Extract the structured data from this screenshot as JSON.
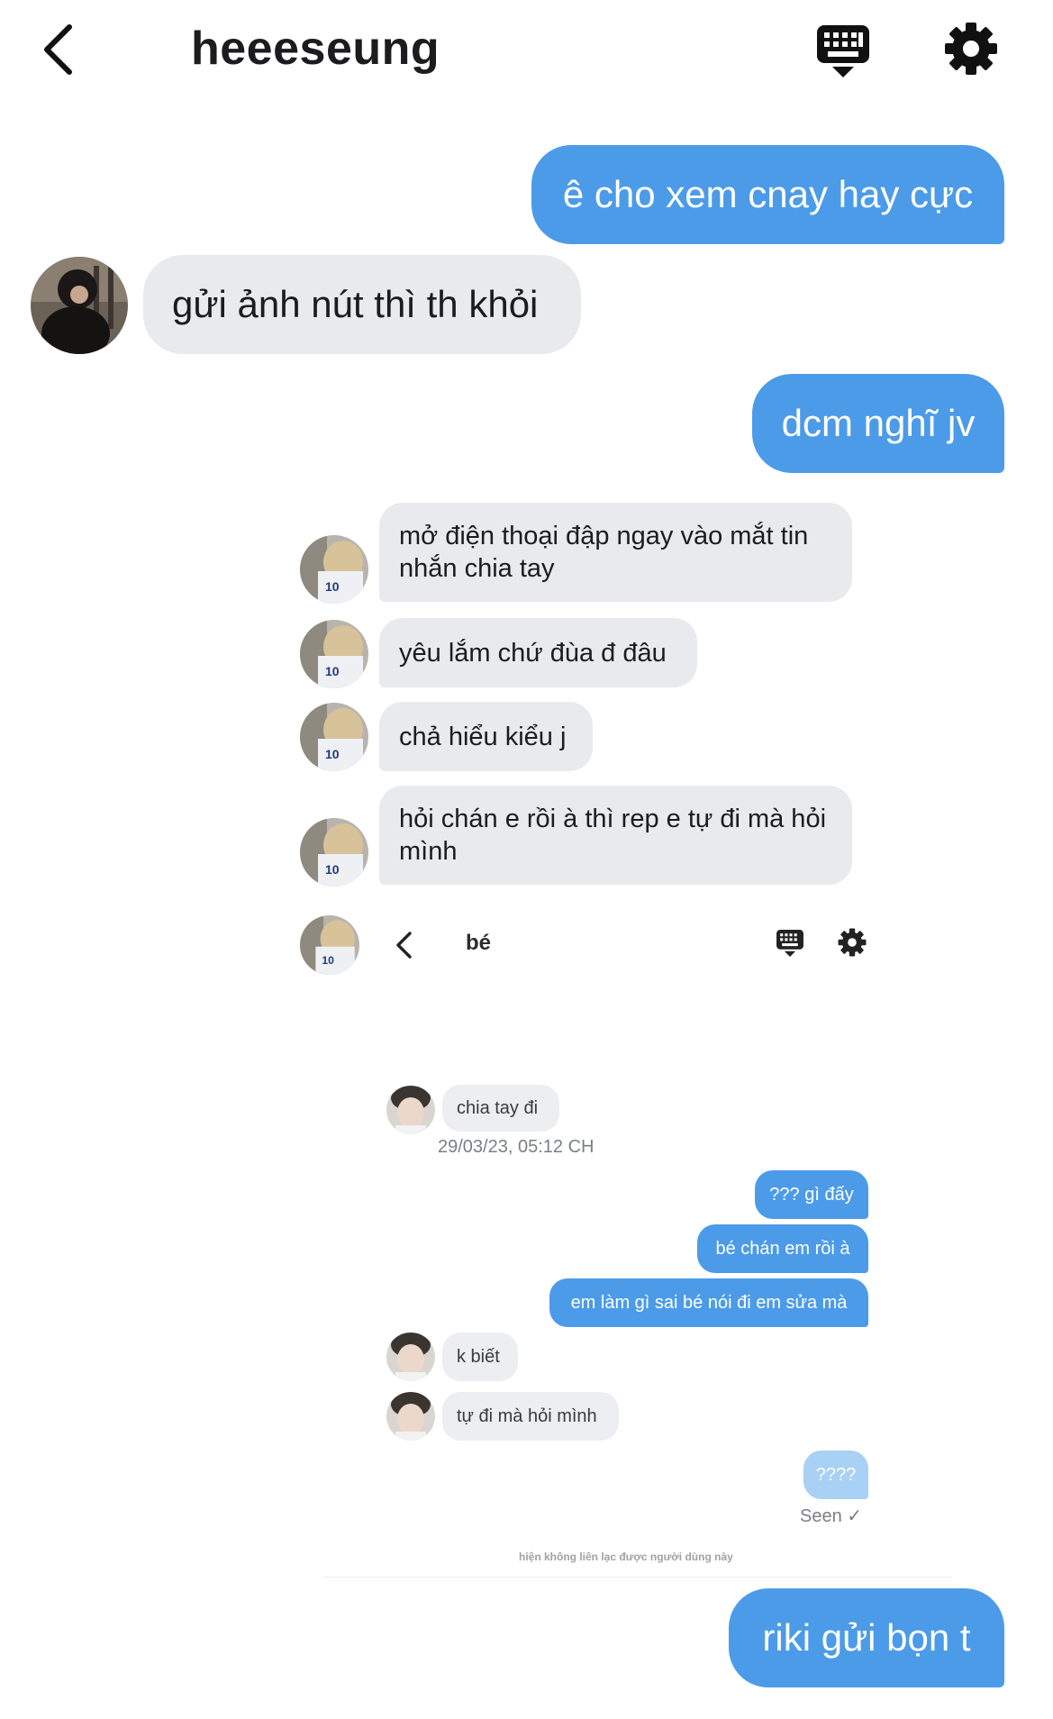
{
  "header": {
    "title": "heeeseung"
  },
  "messages_top": [
    {
      "text": "ê cho xem cnay hay cực"
    },
    {
      "text": "gửi ảnh nút thì th khỏi"
    },
    {
      "text": "dcm nghĩ jv"
    }
  ],
  "embedded_messages": [
    {
      "text": "mở điện thoại đập ngay vào mắt tin nhắn chia tay"
    },
    {
      "text": "yêu lắm chứ đùa đ đâu"
    },
    {
      "text": "chả hiểu kiểu j"
    },
    {
      "text": "hỏi chán e rồi à thì rep e tự đi mà hỏi mình"
    }
  ],
  "inner_chat": {
    "title": "bé",
    "messages": [
      {
        "text": "chia tay đi"
      },
      {
        "text": "??? gì đấy"
      },
      {
        "text": "bé chán em rồi à"
      },
      {
        "text": "em làm gì sai bé nói đi em sửa mà"
      },
      {
        "text": "k biết"
      },
      {
        "text": "tự đi mà hỏi mình"
      },
      {
        "text": "????"
      }
    ],
    "timestamp": "29/03/23, 05:12 CH",
    "seen_label": "Seen ✓",
    "notice": "hiện không liên lạc được người dùng này"
  },
  "last_message": {
    "text": "riki gửi bọn t"
  },
  "icons": {
    "back": "chevron-left-icon",
    "keyboard": "keyboard-icon",
    "settings": "gear-icon"
  },
  "colors": {
    "outgoing_bubble": "#4c9be8",
    "incoming_bubble": "#e8eaee",
    "pending_bubble": "#a9d0f5"
  }
}
